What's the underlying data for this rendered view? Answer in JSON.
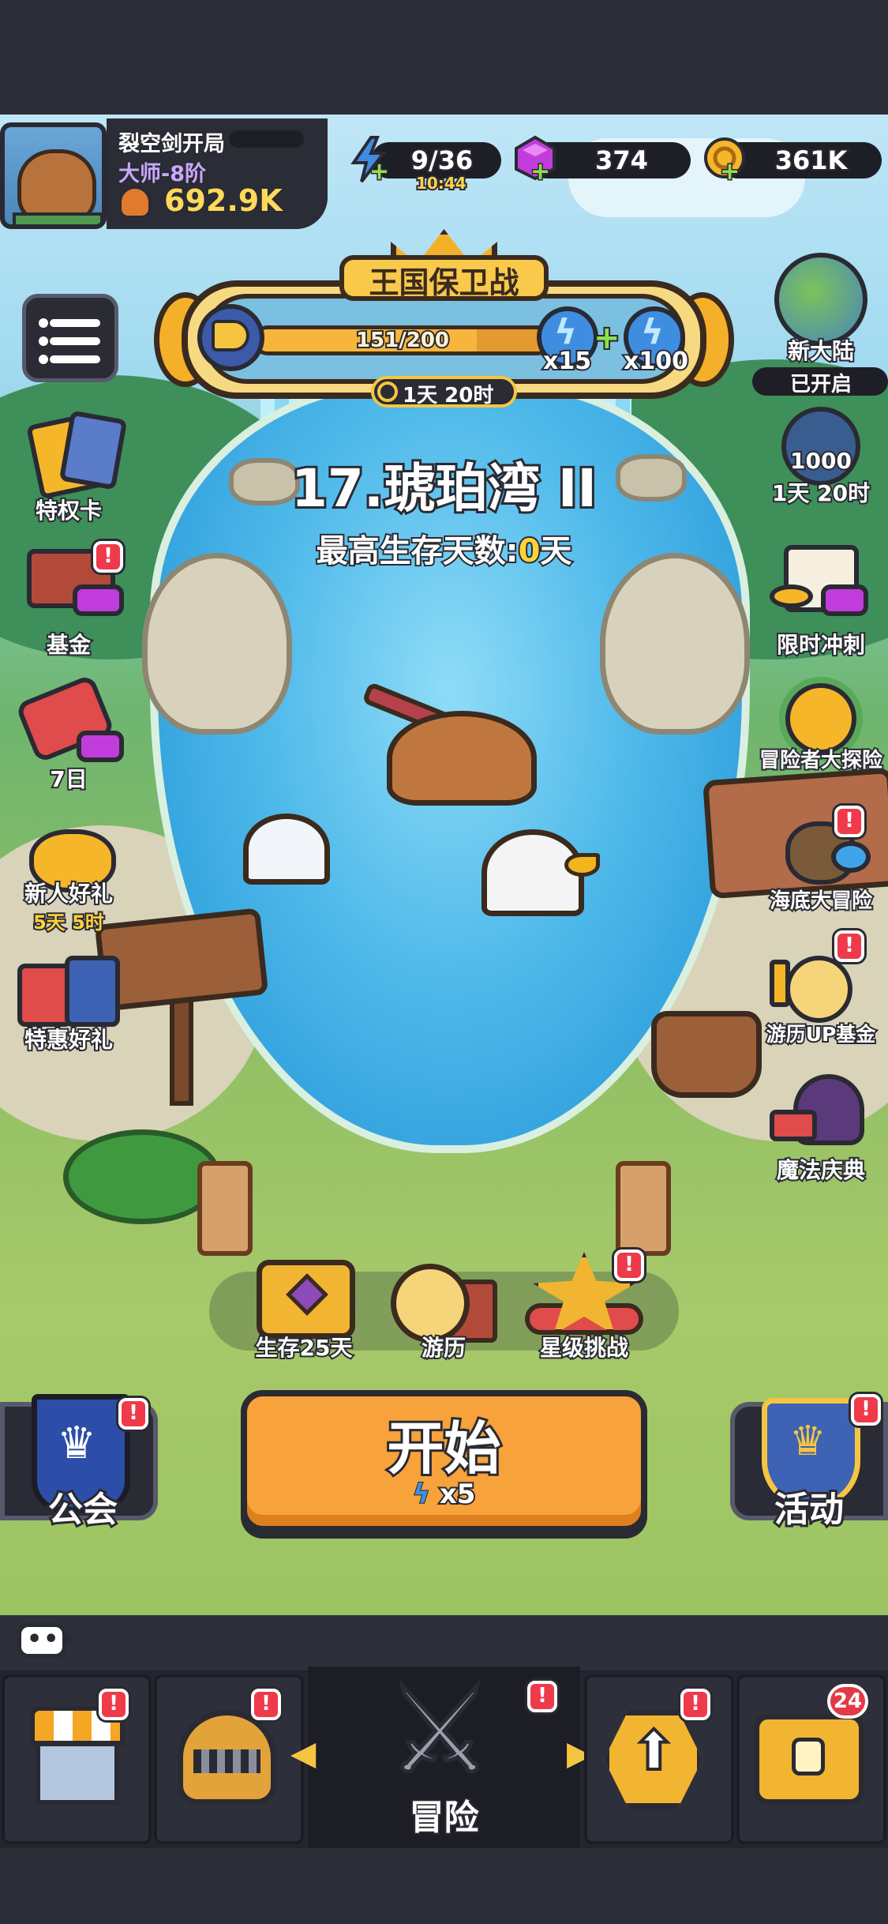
{
  "player": {
    "name": "裂空剑开局",
    "rank": "大师-8阶",
    "power": "692.9K"
  },
  "resources": {
    "energy": "9/36",
    "energy_timer": "10:44",
    "gems": "374",
    "coins": "361K"
  },
  "event": {
    "title": "王国保卫战",
    "progress": "151/200",
    "progress_ratio": 0.755,
    "reward_1": "x15",
    "reward_2": "x100",
    "timer": "1天 20时"
  },
  "stage": {
    "title": "17.琥珀湾 II",
    "best_prefix": "最高生存天数:",
    "best_value": "0",
    "best_suffix": "天"
  },
  "left_side": [
    {
      "label": "特权卡"
    },
    {
      "label": "基金"
    },
    {
      "label": "7日"
    },
    {
      "label": "新人好礼",
      "sub": "5天 5时"
    },
    {
      "label": "特惠好礼"
    }
  ],
  "right_side": [
    {
      "label": "新大陆",
      "sub": "已开启"
    },
    {
      "label": "1000",
      "sub": "1天 20时"
    },
    {
      "label": "限时冲刺"
    },
    {
      "label": "冒险者大探险"
    },
    {
      "label": "海底大冒险"
    },
    {
      "label": "游历UP基金"
    },
    {
      "label": "魔法庆典"
    }
  ],
  "tray": {
    "survive": "生存25天",
    "travel": "游历",
    "star": "星级挑战"
  },
  "start": {
    "label": "开始",
    "cost": "x5"
  },
  "guild": {
    "label": "公会"
  },
  "activity": {
    "label": "活动"
  },
  "nav": {
    "center_label": "冒险",
    "chest_count": "24"
  },
  "alert_mark": "!"
}
